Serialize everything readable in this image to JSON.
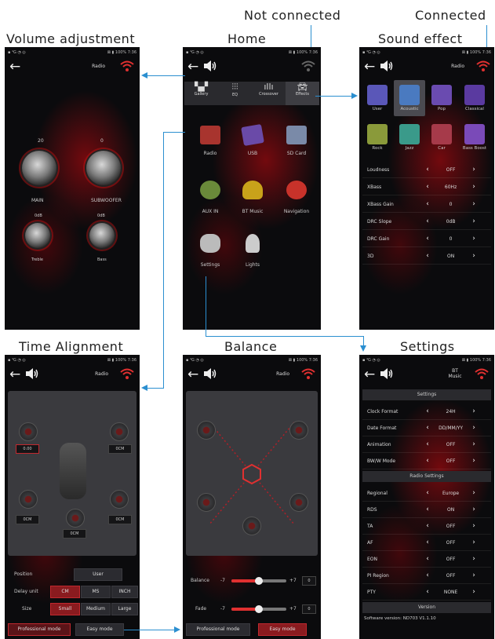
{
  "captions": {
    "not_connected": "Not connected",
    "connected": "Connected",
    "volume": "Volume adjustment",
    "home": "Home",
    "sound": "Sound effect",
    "time": "Time Alignment",
    "balance": "Balance",
    "settings": "Settings"
  },
  "common": {
    "back": "←",
    "radio": "Radio",
    "status_right": "⊠ ▮ 100% 7:36"
  },
  "volume": {
    "main_value": "20",
    "sub_value": "0",
    "main_label": "MAIN",
    "sub_label": "SUBWOOFER",
    "treble_value": "0dB",
    "bass_value": "0dB",
    "treble_label": "Treble",
    "bass_label": "Bass"
  },
  "home": {
    "tabs": [
      "Gallery",
      "EQ",
      "Crossover",
      "Effects"
    ],
    "apps": [
      "Radio",
      "USB",
      "SD Card",
      "AUX IN",
      "BT Music",
      "Navigation",
      "Settings",
      "Lights"
    ]
  },
  "sound": {
    "presets": [
      {
        "name": "User",
        "color": "#5a57b8"
      },
      {
        "name": "Acoustic",
        "color": "#4a7ac0"
      },
      {
        "name": "Pop",
        "color": "#6a4bb0"
      },
      {
        "name": "Classical",
        "color": "#5a3aa0"
      },
      {
        "name": "Rock",
        "color": "#8a9a3a"
      },
      {
        "name": "Jazz",
        "color": "#3a9a8a"
      },
      {
        "name": "Car",
        "color": "#a63a4a"
      },
      {
        "name": "Bass Boost",
        "color": "#7a4ab8"
      }
    ],
    "rows": [
      {
        "label": "Loudness",
        "value": "OFF"
      },
      {
        "label": "XBass",
        "value": "60Hz"
      },
      {
        "label": "XBass Gain",
        "value": "0"
      },
      {
        "label": "DRC Slope",
        "value": "0dB"
      },
      {
        "label": "DRC Gain",
        "value": "0"
      },
      {
        "label": "3D",
        "value": "ON"
      }
    ]
  },
  "time": {
    "chips": [
      "0.00",
      "0CM",
      "0CM",
      "0CM",
      "0CM"
    ],
    "position_label": "Position",
    "position_value": "User",
    "delay_label": "Delay unit",
    "delay_opts": [
      "CM",
      "MS",
      "INCH"
    ],
    "size_label": "Size",
    "size_opts": [
      "Small",
      "Medium",
      "Large"
    ],
    "pro_mode": "Professional mode",
    "easy_mode": "Easy mode"
  },
  "balance": {
    "balance_label": "Balance",
    "balance_min": "-7",
    "balance_max": "+7",
    "balance_value": "0",
    "balance_level": 0.5,
    "fade_label": "Fade",
    "fade_min": "-7",
    "fade_max": "+7",
    "fade_value": "0",
    "fade_level": 0.5,
    "pro_mode": "Professional mode",
    "easy_mode": "Easy mode"
  },
  "settings": {
    "title": "BT Music",
    "section1": "Settings",
    "rows1": [
      {
        "label": "Clock Format",
        "value": "24H"
      },
      {
        "label": "Date Format",
        "value": "DD/MM/YY"
      },
      {
        "label": "Animation",
        "value": "OFF"
      },
      {
        "label": "BW/W Mode",
        "value": "OFF"
      }
    ],
    "section2": "Radio Settings",
    "rows2": [
      {
        "label": "Regional",
        "value": "Europe"
      },
      {
        "label": "RDS",
        "value": "ON"
      },
      {
        "label": "TA",
        "value": "OFF"
      },
      {
        "label": "AF",
        "value": "OFF"
      },
      {
        "label": "EON",
        "value": "OFF"
      },
      {
        "label": "PI Region",
        "value": "OFF"
      },
      {
        "label": "PTY",
        "value": "NONE"
      }
    ],
    "section3": "Version",
    "version": "Software version: ND703 V1.1.10"
  },
  "colors": {
    "accent_red": "#e03030",
    "arrow_blue": "#2b8fd0"
  }
}
